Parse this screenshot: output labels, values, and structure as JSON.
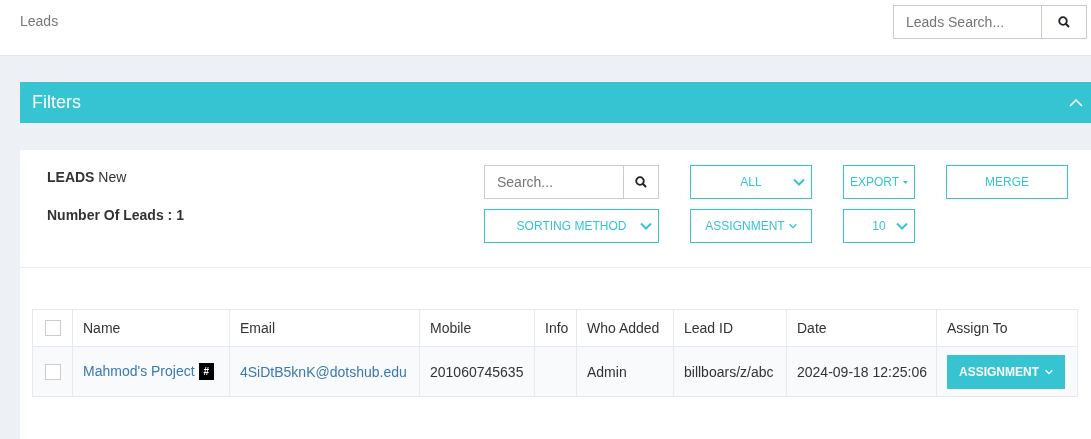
{
  "page": {
    "title": "Leads"
  },
  "top_search": {
    "placeholder": "Leads Search..."
  },
  "filters": {
    "title": "Filters",
    "expanded": true
  },
  "summary": {
    "heading": "LEADS",
    "status": "New",
    "count_label": "Number Of Leads : 1"
  },
  "controls": {
    "search": {
      "placeholder": "Search..."
    },
    "items": [
      {
        "kind": "select",
        "label": "ALL"
      },
      {
        "kind": "dropdown",
        "label": "EXPORT"
      },
      {
        "kind": "button",
        "label": "MERGE"
      },
      {
        "kind": "select",
        "label": "SORTING METHOD"
      },
      {
        "kind": "menu",
        "label": "ASSIGNMENT"
      },
      {
        "kind": "select",
        "label": "10"
      }
    ]
  },
  "table": {
    "select_all": {
      "checked": false
    },
    "columns": [
      "Name",
      "Email",
      "Mobile",
      "Info",
      "Who Added",
      "Lead ID",
      "Date",
      "Assign To"
    ],
    "rows": [
      {
        "checked": false,
        "name": "Mahmod's Project",
        "tag": "#",
        "email": "4SiDtB5knK@dotshub.edu",
        "mobile": "201060745635",
        "info": "",
        "who_added": "Admin",
        "lead_id": "billboars/z/abc",
        "date": "2024-09-18 12:25:06",
        "action": "ASSIGNMENT"
      }
    ]
  }
}
